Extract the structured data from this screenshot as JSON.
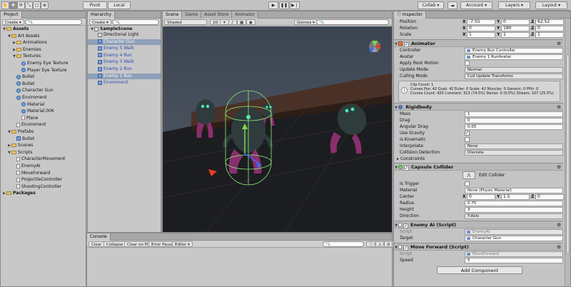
{
  "toolbar": {
    "pivot": "Pivot",
    "local": "Local",
    "collab": "Collab",
    "account": "Account",
    "layers": "Layers",
    "layout": "Layout"
  },
  "project": {
    "tab": "Project",
    "create": "Create",
    "tree": [
      {
        "label": "Assets",
        "depth": 0,
        "kind": "folder",
        "open": true,
        "bold": true
      },
      {
        "label": "Art Assets",
        "depth": 1,
        "kind": "folder",
        "open": true
      },
      {
        "label": "Animations",
        "depth": 2,
        "kind": "folder"
      },
      {
        "label": "Enemies",
        "depth": 2,
        "kind": "folder"
      },
      {
        "label": "Textures",
        "depth": 2,
        "kind": "folder",
        "open": true
      },
      {
        "label": "Enemy Eye Texture",
        "depth": 3,
        "kind": "sphere"
      },
      {
        "label": "Player Eye Texture",
        "depth": 3,
        "kind": "sphere"
      },
      {
        "label": "Bullet",
        "depth": 2,
        "kind": "sphere"
      },
      {
        "label": "Bullet",
        "depth": 2,
        "kind": "sphere"
      },
      {
        "label": "Character Gun",
        "depth": 2,
        "kind": "sphere"
      },
      {
        "label": "Enviroment",
        "depth": 2,
        "kind": "sphere"
      },
      {
        "label": "Material",
        "depth": 3,
        "kind": "sphere"
      },
      {
        "label": "Material.006",
        "depth": 3,
        "kind": "sphere"
      },
      {
        "label": "Plane",
        "depth": 3,
        "kind": "file"
      },
      {
        "label": "Enviroment",
        "depth": 2,
        "kind": "file"
      },
      {
        "label": "Prefabs",
        "depth": 1,
        "kind": "folder",
        "open": true
      },
      {
        "label": "Bullet",
        "depth": 2,
        "kind": "cube"
      },
      {
        "label": "Scenes",
        "depth": 1,
        "kind": "folder"
      },
      {
        "label": "Scripts",
        "depth": 1,
        "kind": "folder",
        "open": true
      },
      {
        "label": "CharacterMovement",
        "depth": 2,
        "kind": "file"
      },
      {
        "label": "EnemyAI",
        "depth": 2,
        "kind": "file"
      },
      {
        "label": "MoveForward",
        "depth": 2,
        "kind": "file"
      },
      {
        "label": "ProjectileController",
        "depth": 2,
        "kind": "file"
      },
      {
        "label": "ShootingController",
        "depth": 2,
        "kind": "file"
      },
      {
        "label": "Packages",
        "depth": 0,
        "kind": "folder",
        "bold": true
      }
    ]
  },
  "hierarchy": {
    "tab": "Hierarchy",
    "create": "Create",
    "scene": "SampleScene",
    "items": [
      {
        "label": "Directional Light",
        "blue": false,
        "selected": false
      },
      {
        "label": "Character Gun",
        "blue": true,
        "selected": true
      },
      {
        "label": "Enemy 5 Walk",
        "blue": true,
        "selected": false
      },
      {
        "label": "Enemy 4 Run",
        "blue": true,
        "selected": false
      },
      {
        "label": "Enemy 3 Walk",
        "blue": true,
        "selected": false
      },
      {
        "label": "Enemy 2 Run",
        "blue": true,
        "selected": false
      },
      {
        "label": "Enemy 1 Run",
        "blue": true,
        "selected": true
      },
      {
        "label": "Enviroment",
        "blue": true,
        "selected": false
      }
    ]
  },
  "scene": {
    "tabs": [
      "Scene",
      "Game",
      "Asset Store",
      "Animator"
    ],
    "shading": "Shaded",
    "mode2d": "2D",
    "gizmos": "Gizmos"
  },
  "console": {
    "tab": "Console",
    "buttons": [
      "Clear",
      "Collapse",
      "Clear on Play",
      "Error Pause",
      "Editor"
    ],
    "count_info": "0",
    "count_warn": "0",
    "count_error": "0"
  },
  "inspector": {
    "tab": "Inspector",
    "transform": {
      "position_label": "Position",
      "rotation_label": "Rotation",
      "scale_label": "Scale",
      "position": {
        "x": "-7.55",
        "y": "0",
        "z": "62.52"
      },
      "rotation": {
        "x": "0",
        "y": "180",
        "z": "0"
      },
      "scale": {
        "x": "1",
        "y": "1",
        "z": "1"
      }
    },
    "animator": {
      "title": "Animator",
      "controller_label": "Controller",
      "controller": "Enemy Run Controller",
      "avatar_label": "Avatar",
      "avatar": "Enemy 1 RunAvatar",
      "apply_root_label": "Apply Root Motion",
      "update_mode_label": "Update Mode",
      "update_mode": "Normal",
      "culling_mode_label": "Culling Mode",
      "culling_mode": "Cull Update Transforms",
      "info1": "Clip Count: 1",
      "info2": "Curves Pos: 42 Quat: 42 Euler: 0 Scale: 42 Muscles: 0 Generic: 0 PPtr: 0",
      "info3": "Curves Count: 420 Constant: 313 (74.5%) Dense: 0 (0.0%) Stream: 107 (25.5%)"
    },
    "rigidbody": {
      "title": "Rigidbody",
      "mass_label": "Mass",
      "mass": "1",
      "drag_label": "Drag",
      "drag": "0",
      "angular_drag_label": "Angular Drag",
      "angular_drag": "0.05",
      "use_gravity_label": "Use Gravity",
      "use_gravity": "✓",
      "is_kinematic_label": "Is Kinematic",
      "interpolate_label": "Interpolate",
      "interpolate": "None",
      "collision_label": "Collision Detection",
      "collision": "Discrete",
      "constraints_label": "Constraints"
    },
    "capsule": {
      "title": "Capsule Collider",
      "edit_label": "Edit Collider",
      "is_trigger_label": "Is Trigger",
      "material_label": "Material",
      "material": "None (Physic Material)",
      "center_label": "Center",
      "center": {
        "x": "0",
        "y": "1.5",
        "z": "0"
      },
      "radius_label": "Radius",
      "radius": "0.75",
      "height_label": "Height",
      "height": "3",
      "direction_label": "Direction",
      "direction": "Y-Axis"
    },
    "enemy_ai": {
      "title": "Enemy AI (Script)",
      "script_label": "Script",
      "script": "EnemyAI",
      "target_label": "Target",
      "target": "Character Gun"
    },
    "move_forward": {
      "title": "Move Forward (Script)",
      "script_label": "Script",
      "script": "MoveForward",
      "speed_label": "Speed",
      "speed": "5"
    },
    "add_component": "Add Component"
  },
  "colors": {
    "editor_bg": "#c2c2c2",
    "selection": "#8e9fb8",
    "prefab_blue": "#2a48b8",
    "scene_sky": "#3e4a58",
    "floor": "#1e1e20",
    "wall": "#4a3026",
    "enemy_body": "#2f3b3c",
    "enemy_legs": "#8a2f6e",
    "enemy_eye": "#48e8b8",
    "collider": "#8ef07a"
  }
}
